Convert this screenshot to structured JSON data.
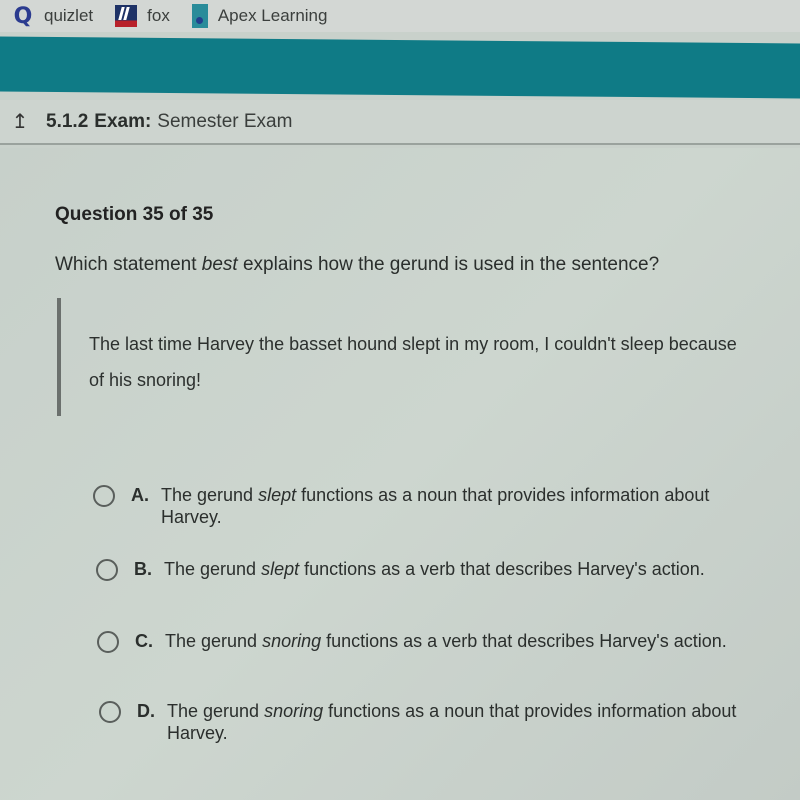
{
  "bookmarks": [
    {
      "label": "quizlet",
      "icon": "quizlet-icon"
    },
    {
      "label": "fox",
      "icon": "fox-icon"
    },
    {
      "label": "Apex Learning",
      "icon": "apex-learning-icon"
    }
  ],
  "header": {
    "number": "5.1.2",
    "label": "Exam:",
    "title": "Semester Exam",
    "back_icon": "↥"
  },
  "colors": {
    "brand_teal": "#0f7b86"
  },
  "question": {
    "number_text": "Question 35 of 35",
    "prompt_before": "Which statement ",
    "prompt_emphasis": "best",
    "prompt_after": " explains how the gerund is used in the sentence?",
    "quote": "The last time Harvey the basset hound slept in my room, I couldn't sleep because of his snoring!"
  },
  "answers": [
    {
      "letter": "A.",
      "before": "The gerund ",
      "term": "slept",
      "after": " functions as a noun that provides information about Harvey.",
      "selected": false
    },
    {
      "letter": "B.",
      "before": "The gerund ",
      "term": "slept",
      "after": " functions as a verb that describes Harvey's action.",
      "selected": false
    },
    {
      "letter": "C.",
      "before": "The gerund ",
      "term": "snoring",
      "after": " functions as a verb that describes Harvey's action.",
      "selected": false
    },
    {
      "letter": "D.",
      "before": "The gerund ",
      "term": "snoring",
      "after": " functions as a noun that provides information about Harvey.",
      "selected": false
    }
  ]
}
